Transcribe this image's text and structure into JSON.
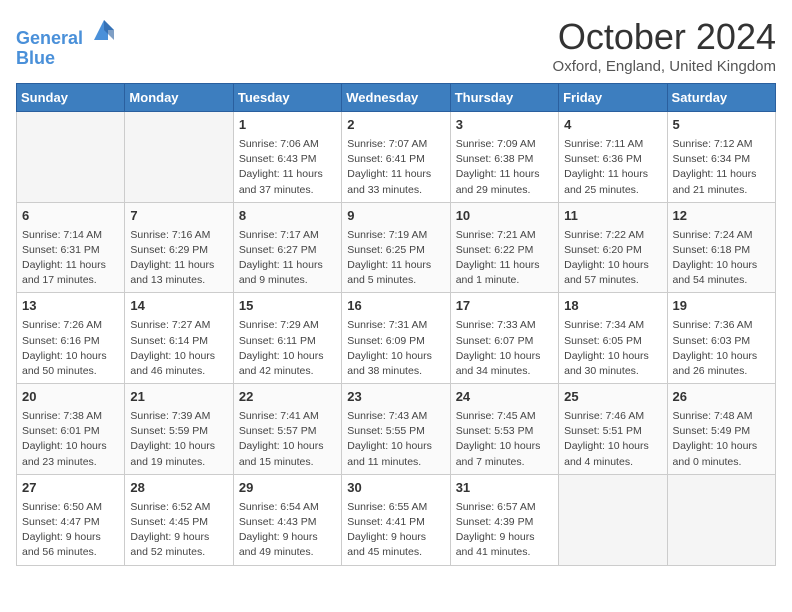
{
  "header": {
    "logo_line1": "General",
    "logo_line2": "Blue",
    "month": "October 2024",
    "location": "Oxford, England, United Kingdom"
  },
  "weekdays": [
    "Sunday",
    "Monday",
    "Tuesday",
    "Wednesday",
    "Thursday",
    "Friday",
    "Saturday"
  ],
  "weeks": [
    [
      {
        "day": "",
        "info": ""
      },
      {
        "day": "",
        "info": ""
      },
      {
        "day": "1",
        "info": "Sunrise: 7:06 AM\nSunset: 6:43 PM\nDaylight: 11 hours and 37 minutes."
      },
      {
        "day": "2",
        "info": "Sunrise: 7:07 AM\nSunset: 6:41 PM\nDaylight: 11 hours and 33 minutes."
      },
      {
        "day": "3",
        "info": "Sunrise: 7:09 AM\nSunset: 6:38 PM\nDaylight: 11 hours and 29 minutes."
      },
      {
        "day": "4",
        "info": "Sunrise: 7:11 AM\nSunset: 6:36 PM\nDaylight: 11 hours and 25 minutes."
      },
      {
        "day": "5",
        "info": "Sunrise: 7:12 AM\nSunset: 6:34 PM\nDaylight: 11 hours and 21 minutes."
      }
    ],
    [
      {
        "day": "6",
        "info": "Sunrise: 7:14 AM\nSunset: 6:31 PM\nDaylight: 11 hours and 17 minutes."
      },
      {
        "day": "7",
        "info": "Sunrise: 7:16 AM\nSunset: 6:29 PM\nDaylight: 11 hours and 13 minutes."
      },
      {
        "day": "8",
        "info": "Sunrise: 7:17 AM\nSunset: 6:27 PM\nDaylight: 11 hours and 9 minutes."
      },
      {
        "day": "9",
        "info": "Sunrise: 7:19 AM\nSunset: 6:25 PM\nDaylight: 11 hours and 5 minutes."
      },
      {
        "day": "10",
        "info": "Sunrise: 7:21 AM\nSunset: 6:22 PM\nDaylight: 11 hours and 1 minute."
      },
      {
        "day": "11",
        "info": "Sunrise: 7:22 AM\nSunset: 6:20 PM\nDaylight: 10 hours and 57 minutes."
      },
      {
        "day": "12",
        "info": "Sunrise: 7:24 AM\nSunset: 6:18 PM\nDaylight: 10 hours and 54 minutes."
      }
    ],
    [
      {
        "day": "13",
        "info": "Sunrise: 7:26 AM\nSunset: 6:16 PM\nDaylight: 10 hours and 50 minutes."
      },
      {
        "day": "14",
        "info": "Sunrise: 7:27 AM\nSunset: 6:14 PM\nDaylight: 10 hours and 46 minutes."
      },
      {
        "day": "15",
        "info": "Sunrise: 7:29 AM\nSunset: 6:11 PM\nDaylight: 10 hours and 42 minutes."
      },
      {
        "day": "16",
        "info": "Sunrise: 7:31 AM\nSunset: 6:09 PM\nDaylight: 10 hours and 38 minutes."
      },
      {
        "day": "17",
        "info": "Sunrise: 7:33 AM\nSunset: 6:07 PM\nDaylight: 10 hours and 34 minutes."
      },
      {
        "day": "18",
        "info": "Sunrise: 7:34 AM\nSunset: 6:05 PM\nDaylight: 10 hours and 30 minutes."
      },
      {
        "day": "19",
        "info": "Sunrise: 7:36 AM\nSunset: 6:03 PM\nDaylight: 10 hours and 26 minutes."
      }
    ],
    [
      {
        "day": "20",
        "info": "Sunrise: 7:38 AM\nSunset: 6:01 PM\nDaylight: 10 hours and 23 minutes."
      },
      {
        "day": "21",
        "info": "Sunrise: 7:39 AM\nSunset: 5:59 PM\nDaylight: 10 hours and 19 minutes."
      },
      {
        "day": "22",
        "info": "Sunrise: 7:41 AM\nSunset: 5:57 PM\nDaylight: 10 hours and 15 minutes."
      },
      {
        "day": "23",
        "info": "Sunrise: 7:43 AM\nSunset: 5:55 PM\nDaylight: 10 hours and 11 minutes."
      },
      {
        "day": "24",
        "info": "Sunrise: 7:45 AM\nSunset: 5:53 PM\nDaylight: 10 hours and 7 minutes."
      },
      {
        "day": "25",
        "info": "Sunrise: 7:46 AM\nSunset: 5:51 PM\nDaylight: 10 hours and 4 minutes."
      },
      {
        "day": "26",
        "info": "Sunrise: 7:48 AM\nSunset: 5:49 PM\nDaylight: 10 hours and 0 minutes."
      }
    ],
    [
      {
        "day": "27",
        "info": "Sunrise: 6:50 AM\nSunset: 4:47 PM\nDaylight: 9 hours and 56 minutes."
      },
      {
        "day": "28",
        "info": "Sunrise: 6:52 AM\nSunset: 4:45 PM\nDaylight: 9 hours and 52 minutes."
      },
      {
        "day": "29",
        "info": "Sunrise: 6:54 AM\nSunset: 4:43 PM\nDaylight: 9 hours and 49 minutes."
      },
      {
        "day": "30",
        "info": "Sunrise: 6:55 AM\nSunset: 4:41 PM\nDaylight: 9 hours and 45 minutes."
      },
      {
        "day": "31",
        "info": "Sunrise: 6:57 AM\nSunset: 4:39 PM\nDaylight: 9 hours and 41 minutes."
      },
      {
        "day": "",
        "info": ""
      },
      {
        "day": "",
        "info": ""
      }
    ]
  ]
}
